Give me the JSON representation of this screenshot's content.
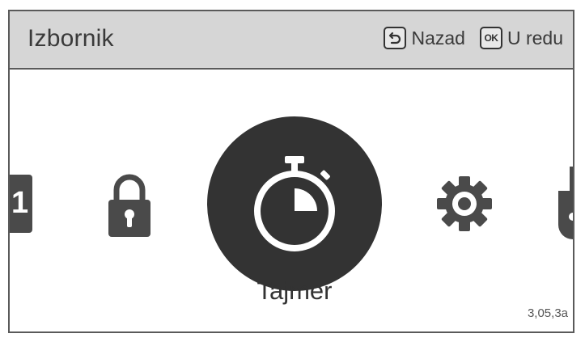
{
  "header": {
    "title": "Izbornik",
    "back_label": "Nazad",
    "ok_key_text": "OK",
    "ok_label": "U redu"
  },
  "carousel": {
    "left_partial_text": "1",
    "items": [
      {
        "icon": "calendar-icon",
        "label": ""
      },
      {
        "icon": "lock-icon",
        "label": ""
      },
      {
        "icon": "stopwatch-icon",
        "label": "Tajmer",
        "selected": true
      },
      {
        "icon": "gear-icon",
        "label": ""
      },
      {
        "icon": "plug-icon",
        "label": ""
      }
    ],
    "selected_label": "Tajmer"
  },
  "page_code": "3,05,3a",
  "colors": {
    "header_bg": "#d6d6d6",
    "icon_fill": "#4a4a4a",
    "selected_bg": "#333333",
    "frame": "#5a5a5a"
  }
}
